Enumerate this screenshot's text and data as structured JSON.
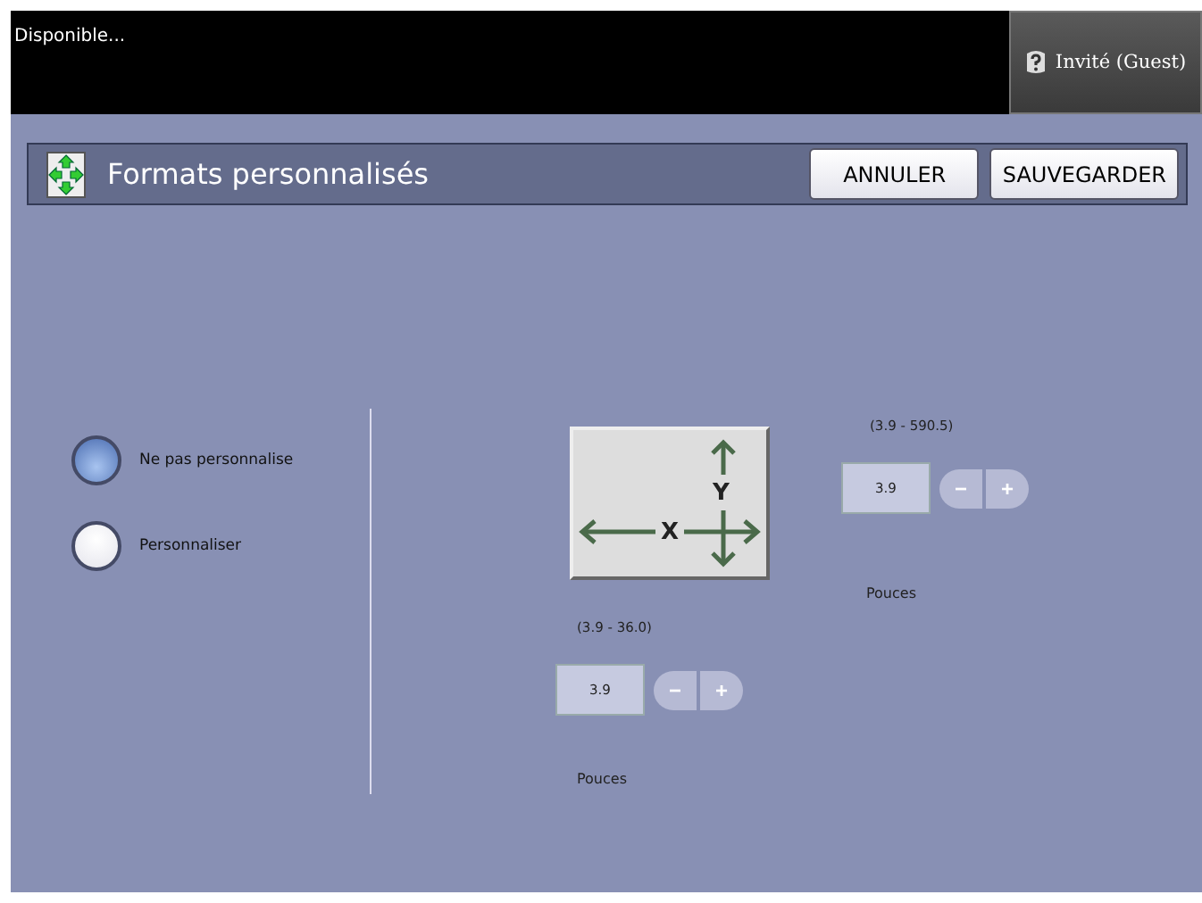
{
  "status": {
    "message": "Disponible...",
    "user": "Invité (Guest)"
  },
  "header": {
    "title": "Formats personnalisés",
    "buttons": [
      "ANNULER",
      "SAUVEGARDER"
    ]
  },
  "options": [
    {
      "label": "Ne pas personnalise",
      "selected": true
    },
    {
      "label": "Personnaliser",
      "selected": false
    }
  ],
  "diagram": {
    "x_label": "X",
    "y_label": "Y"
  },
  "y_field": {
    "range": "(3.9 - 590.5)",
    "value": "3.9",
    "minus": "−",
    "plus": "+",
    "disabled": true,
    "unit": "Pouces"
  },
  "x_field": {
    "range": "(3.9 - 36.0)",
    "value": "3.9",
    "minus": "−",
    "plus": "+",
    "disabled": true,
    "unit": "Pouces"
  }
}
